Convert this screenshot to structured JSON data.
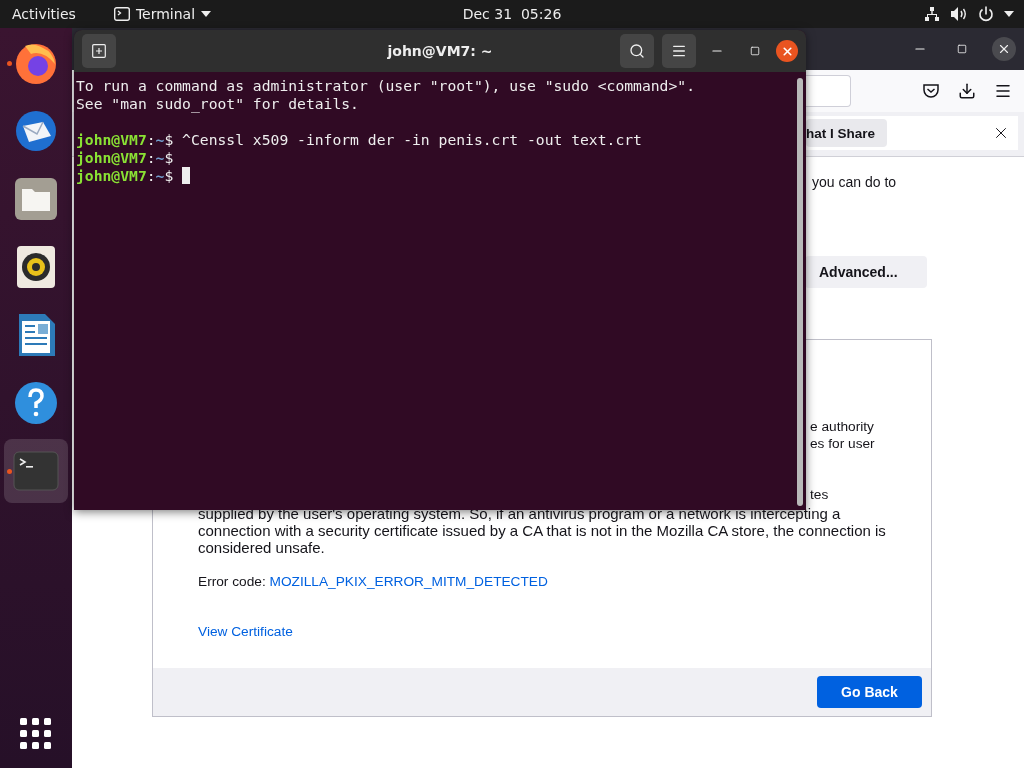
{
  "top_bar": {
    "activities": "Activities",
    "app_menu": "Terminal",
    "clock": "Dec 31  05:26"
  },
  "dock": {
    "items": [
      {
        "kind": "browser",
        "running": true,
        "selected": false
      },
      {
        "kind": "mail",
        "running": false,
        "selected": false
      },
      {
        "kind": "files",
        "running": false,
        "selected": false
      },
      {
        "kind": "music",
        "running": false,
        "selected": false
      },
      {
        "kind": "writer",
        "running": false,
        "selected": false
      },
      {
        "kind": "help",
        "running": false,
        "selected": false
      },
      {
        "kind": "terminal",
        "running": true,
        "selected": true
      }
    ]
  },
  "browser": {
    "notification": {
      "button": "hat I Share"
    },
    "page": {
      "fragment": "you can do to",
      "advanced_button": "Advanced...",
      "details": {
        "fragments": [
          "e authority",
          "es for user",
          "tes"
        ],
        "paragraph": "supplied by the user's operating system. So, if an antivirus program or a network is intercepting a connection with a security certificate issued by a CA that is not in the Mozilla CA store, the connection is considered unsafe.",
        "error_label": "Error code:",
        "error_code": "MOZILLA_PKIX_ERROR_MITM_DETECTED",
        "view_certificate": "View Certificate",
        "go_back": "Go Back"
      }
    }
  },
  "terminal": {
    "title": "john@VM7: ~",
    "lines": [
      {
        "kind": "output",
        "text": "To run a command as administrator (user \"root\"), use \"sudo <command>\"."
      },
      {
        "kind": "output",
        "text": "See \"man sudo_root\" for details."
      },
      {
        "kind": "blank"
      },
      {
        "kind": "prompt",
        "host": "john@VM7",
        "separator": ":",
        "path": "~",
        "symbol": "$",
        "command": "^Censsl x509 -inform der -in penis.crt -out text.crt",
        "cursor": false
      },
      {
        "kind": "prompt",
        "host": "john@VM7",
        "separator": ":",
        "path": "~",
        "symbol": "$",
        "cursor": false
      },
      {
        "kind": "prompt",
        "host": "john@VM7",
        "separator": ":",
        "path": "~",
        "symbol": "$",
        "cursor": true
      }
    ]
  }
}
